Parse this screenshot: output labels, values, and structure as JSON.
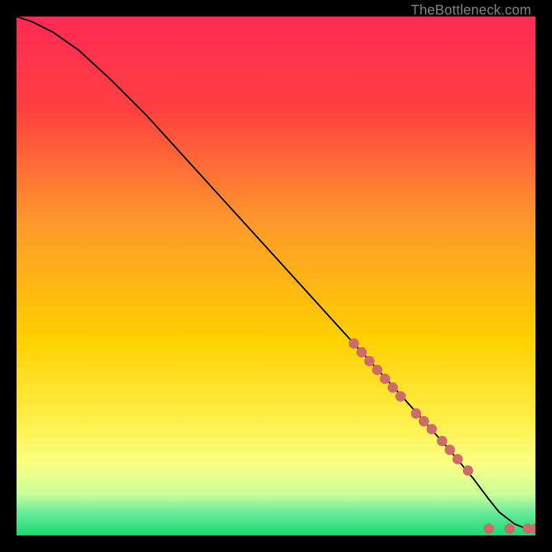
{
  "attribution": "TheBottleneck.com",
  "chart_data": {
    "type": "line",
    "title": "",
    "xlabel": "",
    "ylabel": "",
    "xlim": [
      0,
      100
    ],
    "ylim": [
      0,
      100
    ],
    "gradient_stops": [
      {
        "offset": 0,
        "color": "#ff2a55"
      },
      {
        "offset": 18,
        "color": "#ff4040"
      },
      {
        "offset": 40,
        "color": "#ff9a2a"
      },
      {
        "offset": 62,
        "color": "#ffd000"
      },
      {
        "offset": 78,
        "color": "#ffef4a"
      },
      {
        "offset": 86,
        "color": "#fbff80"
      },
      {
        "offset": 92,
        "color": "#c8ff9a"
      },
      {
        "offset": 96,
        "color": "#5fe89a"
      },
      {
        "offset": 100,
        "color": "#1ed96f"
      }
    ],
    "series": [
      {
        "name": "curve",
        "type": "line",
        "x": [
          0,
          3,
          7,
          12,
          18,
          25,
          35,
          45,
          55,
          65,
          75,
          83,
          88,
          91,
          93,
          96,
          98,
          100
        ],
        "y": [
          100,
          99,
          97,
          93.5,
          88,
          81,
          70,
          59,
          48,
          37,
          26,
          17,
          11,
          7,
          4.5,
          2.2,
          1.4,
          1.2
        ]
      },
      {
        "name": "marker-band",
        "type": "scatter",
        "x": [
          65,
          66.5,
          68,
          69.5,
          71,
          72.5,
          74,
          77,
          78.5,
          80,
          82,
          83.5,
          85,
          87,
          91,
          95,
          98.5,
          100
        ],
        "y": [
          37,
          35.3,
          33.6,
          31.9,
          30.2,
          28.5,
          26.8,
          23.5,
          22,
          20.5,
          18.2,
          16.5,
          14.7,
          12.5,
          1.3,
          1.3,
          1.3,
          1.3
        ]
      }
    ]
  }
}
